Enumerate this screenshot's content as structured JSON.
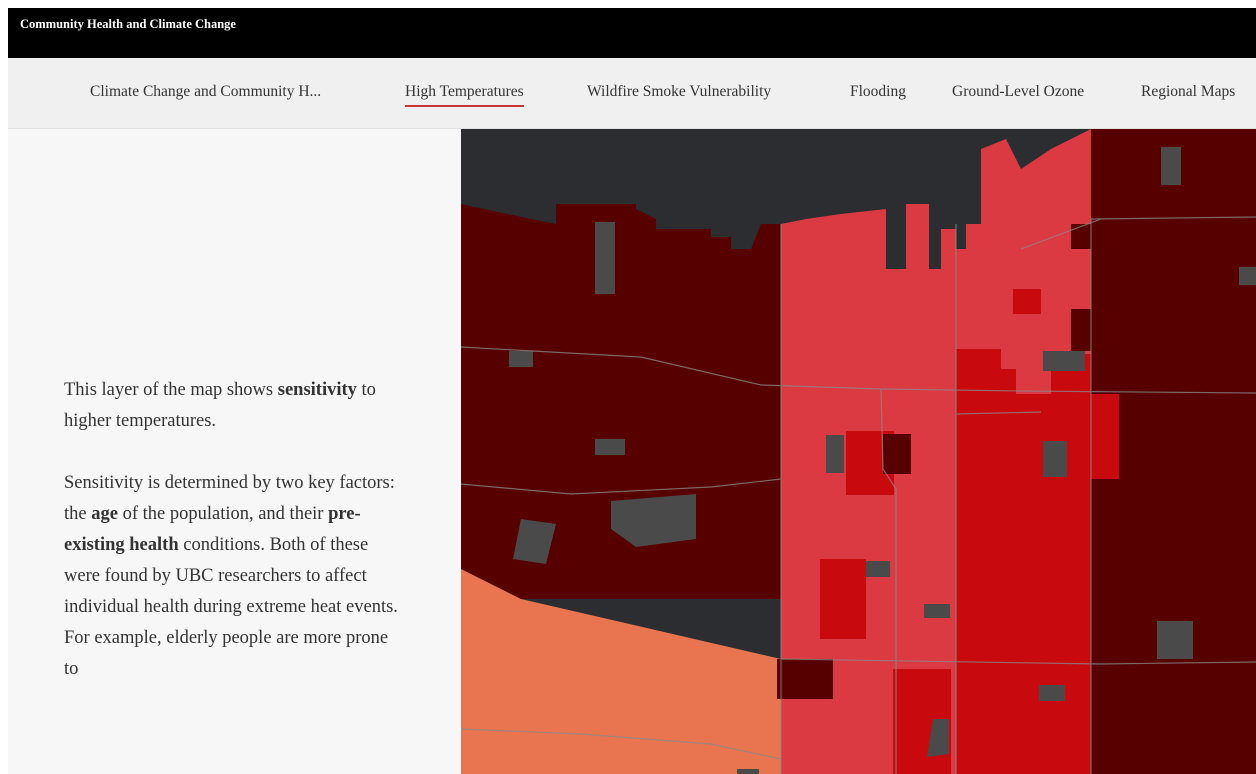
{
  "app": {
    "title": "Community Health and Climate Change"
  },
  "nav": {
    "tabs": [
      {
        "label": "Climate Change and Community H...",
        "active": false
      },
      {
        "label": "High Temperatures",
        "active": true
      },
      {
        "label": "Wildfire Smoke Vulnerability",
        "active": false
      },
      {
        "label": "Flooding",
        "active": false
      },
      {
        "label": "Ground-Level Ozone",
        "active": false
      },
      {
        "label": "Regional Maps",
        "active": false
      }
    ]
  },
  "narrative": {
    "p1_prefix": "This layer of the map shows ",
    "p1_bold": "sensitivity",
    "p1_suffix": " to higher temperatures.",
    "p2_a": "Sensitivity is determined by two key factors: the ",
    "p2_bold1": "age",
    "p2_b": " of the population, and their ",
    "p2_bold2": "pre-existing health",
    "p2_c": " conditions. Both of these were found by UBC researchers to affect individual health during extreme heat events. For example, elderly people are more prone to"
  },
  "colors": {
    "water": "#2c2d30",
    "very_high": "#570000",
    "high": "#c80a0e",
    "moderate": "#dc3a42",
    "low": "#e8754f",
    "no_data": "#4a4a4a",
    "accent": "#c8343a"
  }
}
